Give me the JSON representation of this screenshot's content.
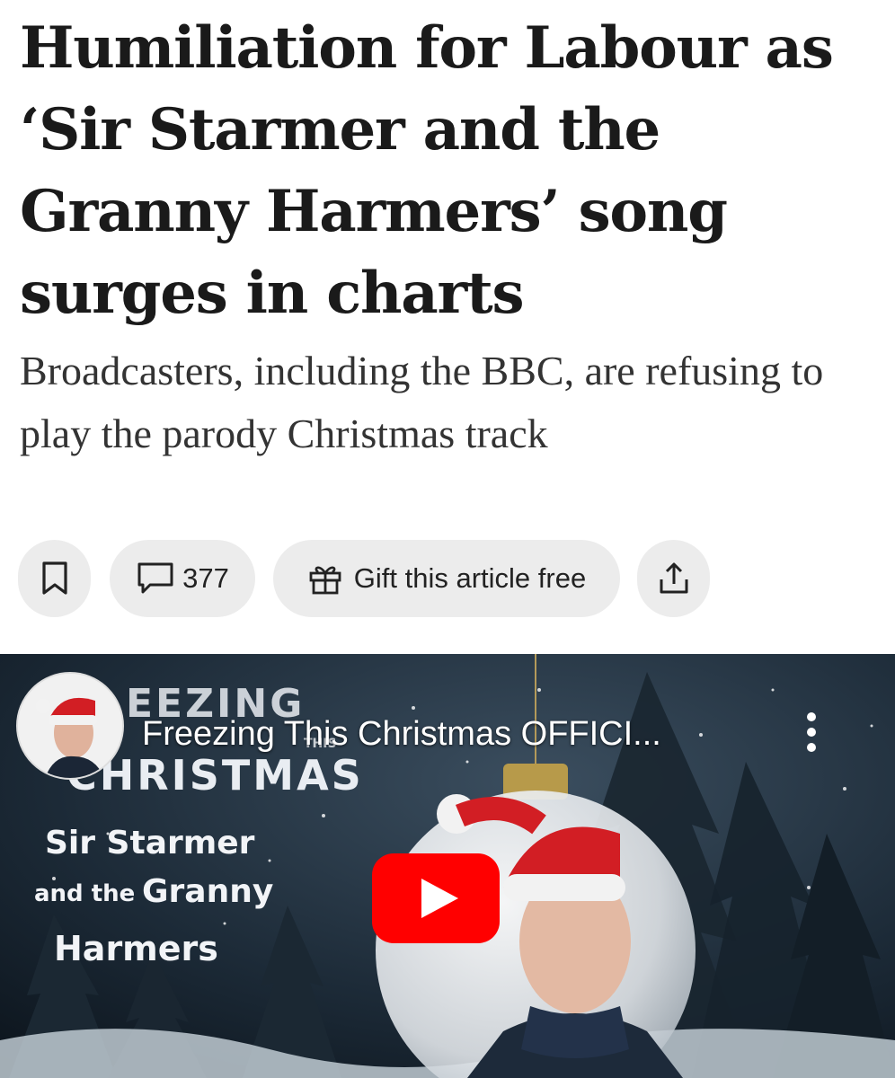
{
  "article": {
    "headline": "Humiliation for Labour as ‘Sir Starmer and the Granny Harmers’ song surges in charts",
    "standfirst": "Broadcasters, including the BBC, are refusing to play the parody Christmas track"
  },
  "actions": {
    "bookmark_icon": "bookmark-icon",
    "comments_icon": "comment-icon",
    "comments_count": "377",
    "gift_icon": "gift-icon",
    "gift_label": "Gift this article free",
    "share_icon": "share-icon"
  },
  "video": {
    "title": "Freezing This Christmas OFFICI...",
    "poster": {
      "line1": "EEZING",
      "line_small": "THIS",
      "line2": "CHRISTMAS",
      "sub1": "Sir Starmer",
      "sub2a": "and the",
      "sub2b": "Granny",
      "sub3": "Harmers"
    },
    "play_icon": "play-icon",
    "menu_icon": "more-vert-icon",
    "colors": {
      "play": "#ff0000",
      "background": "#0f1a24"
    }
  }
}
